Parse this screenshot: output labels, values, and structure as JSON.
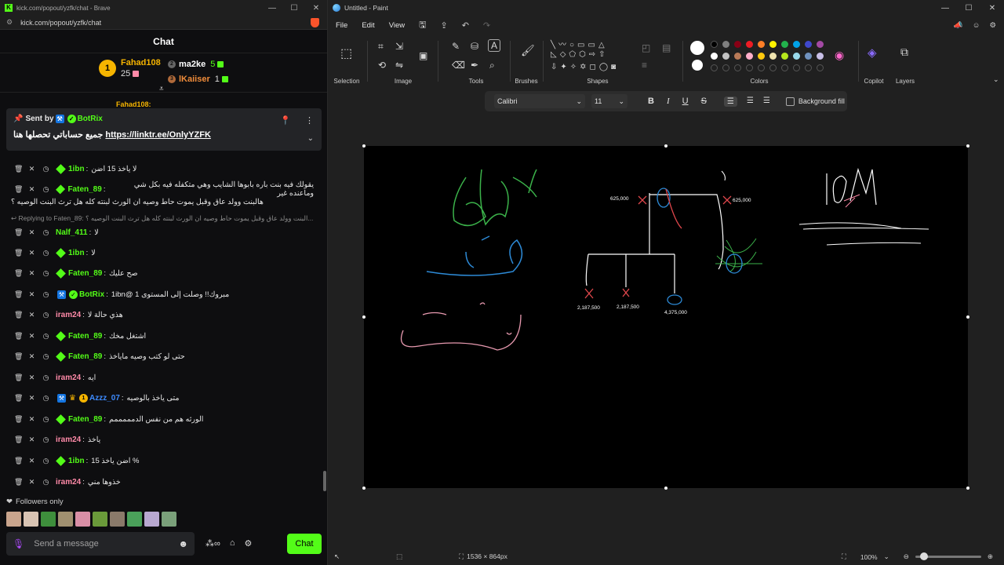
{
  "brave": {
    "window_title": "kick.com/popout/yzfk/chat - Brave",
    "url": "kick.com/popout/yzfk/chat"
  },
  "chat": {
    "header": "Chat",
    "leaderboard": {
      "first": {
        "rank": "1",
        "name": "Fahad108",
        "count": "25"
      },
      "second": {
        "name": "ma2ke",
        "count": "5"
      },
      "third": {
        "name": "lKaiiser",
        "count": "1"
      }
    },
    "pinned": {
      "sent_by_label": "Sent by",
      "sender": "BotRix",
      "message_text": "جميع حساباتي تحصلها هنا",
      "link": "https://linktr.ee/OnlyYZFK"
    },
    "reply_line": "Replying to Faten_89: البنت وولد عاق وقبل يموت حاط وصيه ان الورث لبنته كله هل ترث البنت الوصيه ؟...",
    "messages": [
      {
        "user": "1ibn",
        "color": "#53fc18",
        "badge": "diamond",
        "text": "لا ياخذ 15 اضن"
      },
      {
        "user": "Faten_89",
        "color": "#53fc18",
        "badge": "diamond",
        "text": "يقولك فيه بنت باره بابوها الشايب وهي متكفله فيه بكل شي وماعنده غير"
      },
      {
        "user": "",
        "color": "#eaeaea",
        "badge": "",
        "text": "هالبنت وولد عاق وقبل يموت حاط وصيه ان الورث لبنته كله هل ترث البنت الوصيه ؟"
      },
      {
        "user": "Nalf_411",
        "color": "#53fc18",
        "badge": "",
        "text": "لا"
      },
      {
        "user": "1ibn",
        "color": "#53fc18",
        "badge": "diamond",
        "text": "لا"
      },
      {
        "user": "Faten_89",
        "color": "#53fc18",
        "badge": "diamond",
        "text": "صح عليك"
      },
      {
        "user": "BotRix",
        "color": "#53fc18",
        "badge": "bot",
        "text": "مبروك!! وصلت إلى المستوى 1 @1ibn"
      },
      {
        "user": "iram24",
        "color": "#ff8aa8",
        "badge": "",
        "text": "هذي حالة لا"
      },
      {
        "user": "Faten_89",
        "color": "#53fc18",
        "badge": "diamond",
        "text": "اشتغل مخك"
      },
      {
        "user": "Faten_89",
        "color": "#53fc18",
        "badge": "diamond",
        "text": "حتى لو كتب وصيه ماياخذ"
      },
      {
        "user": "iram24",
        "color": "#ff8aa8",
        "badge": "",
        "text": "ايه"
      },
      {
        "user": "Azzz_07",
        "color": "#3d8bff",
        "badge": "crown",
        "text": "متى ياخذ بالوصيه"
      },
      {
        "user": "Faten_89",
        "color": "#53fc18",
        "badge": "diamond",
        "text": "الورثه هم من نفس الدمممممم"
      },
      {
        "user": "iram24",
        "color": "#ff8aa8",
        "badge": "",
        "text": "ياخذ"
      },
      {
        "user": "1ibn",
        "color": "#53fc18",
        "badge": "diamond",
        "text": "% اضن ياخذ 15"
      },
      {
        "user": "iram24",
        "color": "#ff8aa8",
        "badge": "",
        "text": "خذوها مني"
      }
    ],
    "top_partial": "Fahad108:",
    "followers_only": "Followers only",
    "composer_placeholder": "Send a message",
    "send_button": "Chat"
  },
  "paint": {
    "window_title": "Untitled - Paint",
    "menu": [
      "File",
      "Edit",
      "View"
    ],
    "groups": {
      "selection": "Selection",
      "image": "Image",
      "tools": "Tools",
      "brushes": "Brushes",
      "shapes": "Shapes",
      "colors": "Colors",
      "copilot": "Copilot",
      "layers": "Layers"
    },
    "text_toolbar": {
      "font": "Calibri",
      "size": "11",
      "background_fill": "Background fill"
    },
    "canvas_labels": {
      "left_amount": "625,000",
      "right_amount": "625,000",
      "child1": "2,187,500",
      "child2": "2,187,500",
      "child3": "4,375,000"
    },
    "status": {
      "canvas_size": "1536 × 864px",
      "zoom": "100%"
    }
  },
  "colors": {
    "kick_green": "#53fc18",
    "pink_user": "#ff8aa8",
    "blue_user": "#3d8bff",
    "palette_row1": [
      "#000000",
      "#7f7f7f",
      "#880015",
      "#ed1c24",
      "#ff7f27",
      "#fff200",
      "#22b14c",
      "#00a2e8",
      "#3f48cc",
      "#a349a4"
    ],
    "palette_row2": [
      "#ffffff",
      "#c3c3c3",
      "#b97a57",
      "#ffaec9",
      "#ffc90e",
      "#efe4b0",
      "#b5e61d",
      "#99d9ea",
      "#7092be",
      "#c8bfe7"
    ]
  }
}
